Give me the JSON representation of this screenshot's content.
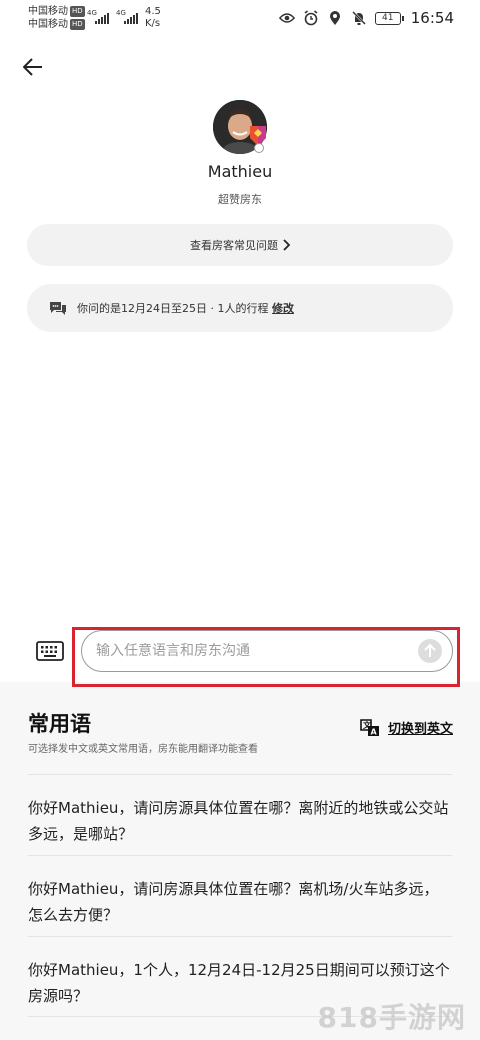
{
  "status_bar": {
    "carrier1": "中国移动",
    "carrier2": "中国移动",
    "hd": "HD",
    "signal_label": "4G",
    "net_speed_value": "4.5",
    "net_speed_unit": "K/s",
    "battery": "41",
    "time": "16:54"
  },
  "host": {
    "name": "Mathieu",
    "subtitle": "超赞房东"
  },
  "faq": {
    "label": "查看房客常见问题"
  },
  "trip": {
    "text": "你问的是12月24日至25日 · 1人的行程",
    "edit_label": "修改"
  },
  "input": {
    "placeholder": "输入任意语言和房东沟通"
  },
  "phrases": {
    "title": "常用语",
    "subtitle": "可选择发中文或英文常用语，房东能用翻译功能查看",
    "translate_label": "切换到英文",
    "items": [
      "你好Mathieu，请问房源具体位置在哪？离附近的地铁或公交站多远，是哪站？",
      "你好Mathieu，请问房源具体位置在哪？离机场/火车站多远，怎么去方便？",
      "你好Mathieu，1个人，12月24日-12月25日期间可以预订这个房源吗？"
    ]
  },
  "watermark": "818手游网",
  "colors": {
    "highlight": "#d9232f",
    "panel_bg": "#f7f7f7",
    "pill_bg": "#f2f2f2"
  }
}
